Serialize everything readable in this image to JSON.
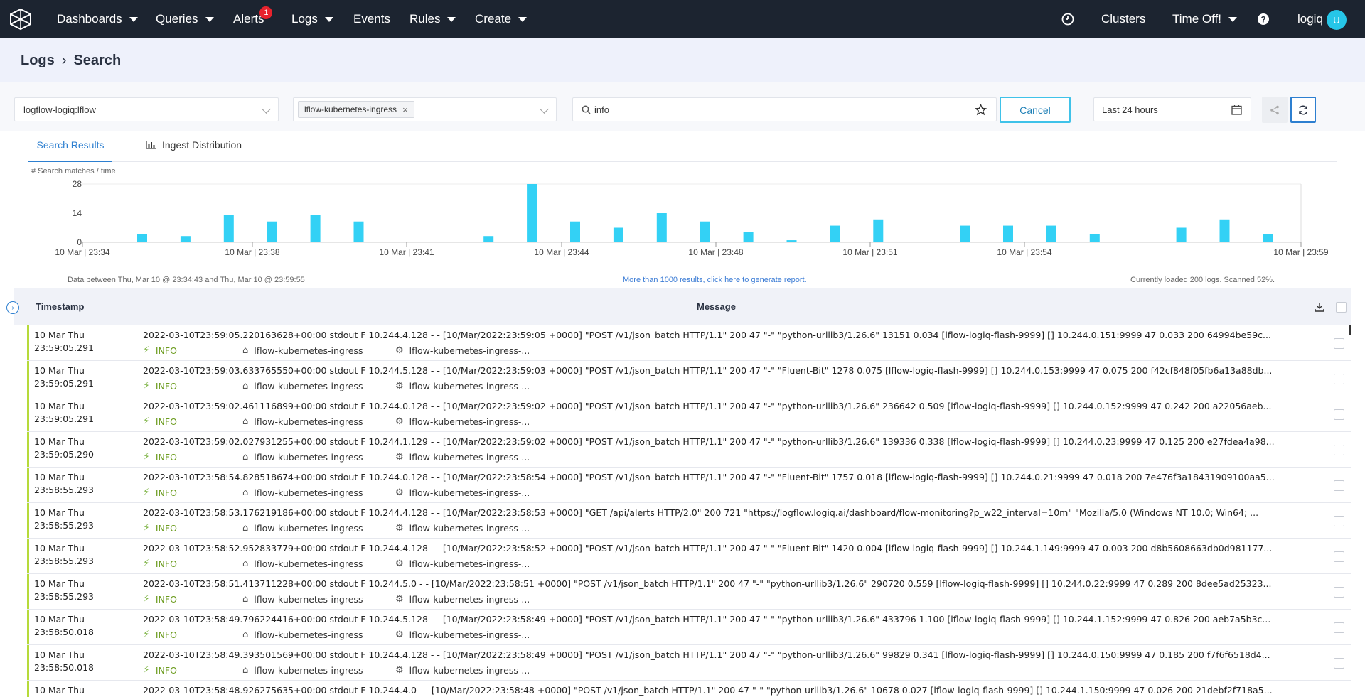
{
  "nav": {
    "items": [
      {
        "label": "Dashboards",
        "caret": true
      },
      {
        "label": "Queries",
        "caret": true
      },
      {
        "label": "Alerts",
        "caret": false,
        "badge": "1"
      },
      {
        "label": "Logs",
        "caret": true
      },
      {
        "label": "Events",
        "caret": false
      },
      {
        "label": "Rules",
        "caret": true
      },
      {
        "label": "Create",
        "caret": true
      }
    ],
    "right": {
      "clusters_label": "Clusters",
      "timeoff_label": "Time Off!",
      "user_label": "logiq",
      "avatar_initial": "U"
    }
  },
  "breadcrumb": {
    "parent": "Logs",
    "current": "Search"
  },
  "filters": {
    "source_value": "logflow-logiq:lflow",
    "app_tag": "lflow-kubernetes-ingress",
    "search_value": "info",
    "cancel_label": "Cancel",
    "time_range": "Last 24 hours"
  },
  "tabs": {
    "active": "Search Results",
    "second": "Ingest Distribution"
  },
  "chart_data": {
    "type": "bar",
    "ylabel": "# Search matches / time",
    "yticks": [
      0,
      14,
      28
    ],
    "ylim": [
      0,
      28
    ],
    "xtick_labels": [
      "10 Mar | 23:34",
      "10 Mar | 23:38",
      "10 Mar | 23:41",
      "10 Mar | 23:44",
      "10 Mar | 23:48",
      "10 Mar | 23:51",
      "10 Mar | 23:54",
      "10 Mar | 23:59"
    ],
    "bar_color": "#33d1f5",
    "values": [
      4,
      3,
      13,
      10,
      13,
      10,
      0,
      0,
      3,
      28,
      10,
      7,
      14,
      10,
      5,
      1,
      8,
      11,
      0,
      8,
      8,
      8,
      4,
      0,
      7,
      11,
      4
    ]
  },
  "summary": {
    "range_text": "Data between  Thu, Mar 10 @ 23:34:43  and Thu, Mar 10 @ 23:59:55",
    "link_text": "More than 1000 results, click here to generate report.",
    "loaded_text": "Currently loaded 200 logs.   Scanned 52%."
  },
  "table": {
    "col_timestamp": "Timestamp",
    "col_message": "Message",
    "rows": [
      {
        "date": "10 Mar Thu",
        "time": "23:59:05.291",
        "message": "2022-03-10T23:59:05.220163628+00:00 stdout F 10.244.4.128 - - [10/Mar/2022:23:59:05 +0000] \"POST /v1/json_batch HTTP/1.1\" 200 47 \"-\" \"python-urllib3/1.26.6\" 13151 0.034 [lflow-logiq-flash-9999] [] 10.244.0.151:9999 47 0.033 200 64994be59c...",
        "level": "INFO",
        "app": "lflow-kubernetes-ingress",
        "proc": "lflow-kubernetes-ingress-..."
      },
      {
        "date": "10 Mar Thu",
        "time": "23:59:05.291",
        "message": "2022-03-10T23:59:03.633765550+00:00 stdout F 10.244.5.128 - - [10/Mar/2022:23:59:03 +0000] \"POST /v1/json_batch HTTP/1.1\" 200 47 \"-\" \"Fluent-Bit\" 1278 0.075 [lflow-logiq-flash-9999] [] 10.244.0.153:9999 47 0.075 200 f42cf848f05fb6a13a88db...",
        "level": "INFO",
        "app": "lflow-kubernetes-ingress",
        "proc": "lflow-kubernetes-ingress-..."
      },
      {
        "date": "10 Mar Thu",
        "time": "23:59:05.291",
        "message": "2022-03-10T23:59:02.461116899+00:00 stdout F 10.244.0.128 - - [10/Mar/2022:23:59:02 +0000] \"POST /v1/json_batch HTTP/1.1\" 200 47 \"-\" \"python-urllib3/1.26.6\" 236642 0.509 [lflow-logiq-flash-9999] [] 10.244.0.152:9999 47 0.242 200 a22056aeb...",
        "level": "INFO",
        "app": "lflow-kubernetes-ingress",
        "proc": "lflow-kubernetes-ingress-..."
      },
      {
        "date": "10 Mar Thu",
        "time": "23:59:05.290",
        "message": "2022-03-10T23:59:02.027931255+00:00 stdout F 10.244.1.129 - - [10/Mar/2022:23:59:02 +0000] \"POST /v1/json_batch HTTP/1.1\" 200 47 \"-\" \"python-urllib3/1.26.6\" 139336 0.338 [lflow-logiq-flash-9999] [] 10.244.0.23:9999 47 0.125 200 e27fdea4a98...",
        "level": "INFO",
        "app": "lflow-kubernetes-ingress",
        "proc": "lflow-kubernetes-ingress-..."
      },
      {
        "date": "10 Mar Thu",
        "time": "23:58:55.293",
        "message": "2022-03-10T23:58:54.828518674+00:00 stdout F 10.244.0.128 - - [10/Mar/2022:23:58:54 +0000] \"POST /v1/json_batch HTTP/1.1\" 200 47 \"-\" \"Fluent-Bit\" 1757 0.018 [lflow-logiq-flash-9999] [] 10.244.0.21:9999 47 0.018 200 7e476f3a18431909100aa5...",
        "level": "INFO",
        "app": "lflow-kubernetes-ingress",
        "proc": "lflow-kubernetes-ingress-..."
      },
      {
        "date": "10 Mar Thu",
        "time": "23:58:55.293",
        "message": "2022-03-10T23:58:53.176219186+00:00 stdout F 10.244.4.128 - - [10/Mar/2022:23:58:53 +0000] \"GET /api/alerts HTTP/2.0\" 200 721 \"https://logflow.logiq.ai/dashboard/flow-monitoring?p_w22_interval=10m\" \"Mozilla/5.0 (Windows NT 10.0; Win64; ...",
        "level": "INFO",
        "app": "lflow-kubernetes-ingress",
        "proc": "lflow-kubernetes-ingress-..."
      },
      {
        "date": "10 Mar Thu",
        "time": "23:58:55.293",
        "message": "2022-03-10T23:58:52.952833779+00:00 stdout F 10.244.4.128 - - [10/Mar/2022:23:58:52 +0000] \"POST /v1/json_batch HTTP/1.1\" 200 47 \"-\" \"Fluent-Bit\" 1420 0.004 [lflow-logiq-flash-9999] [] 10.244.1.149:9999 47 0.003 200 d8b5608663db0d981177...",
        "level": "INFO",
        "app": "lflow-kubernetes-ingress",
        "proc": "lflow-kubernetes-ingress-..."
      },
      {
        "date": "10 Mar Thu",
        "time": "23:58:55.293",
        "message": "2022-03-10T23:58:51.413711228+00:00 stdout F 10.244.5.0 - - [10/Mar/2022:23:58:51 +0000] \"POST /v1/json_batch HTTP/1.1\" 200 47 \"-\" \"python-urllib3/1.26.6\" 290720 0.559 [lflow-logiq-flash-9999] [] 10.244.0.22:9999 47 0.289 200 8dee5ad25323...",
        "level": "INFO",
        "app": "lflow-kubernetes-ingress",
        "proc": "lflow-kubernetes-ingress-..."
      },
      {
        "date": "10 Mar Thu",
        "time": "23:58:50.018",
        "message": "2022-03-10T23:58:49.796224416+00:00 stdout F 10.244.5.128 - - [10/Mar/2022:23:58:49 +0000] \"POST /v1/json_batch HTTP/1.1\" 200 47 \"-\" \"python-urllib3/1.26.6\" 433796 1.100 [lflow-logiq-flash-9999] [] 10.244.1.152:9999 47 0.826 200 aeb7a5b3c...",
        "level": "INFO",
        "app": "lflow-kubernetes-ingress",
        "proc": "lflow-kubernetes-ingress-..."
      },
      {
        "date": "10 Mar Thu",
        "time": "23:58:50.018",
        "message": "2022-03-10T23:58:49.393501569+00:00 stdout F 10.244.4.128 - - [10/Mar/2022:23:58:49 +0000] \"POST /v1/json_batch HTTP/1.1\" 200 47 \"-\" \"python-urllib3/1.26.6\" 99829 0.341 [lflow-logiq-flash-9999] [] 10.244.0.150:9999 47 0.185 200 f7f6f6518d4...",
        "level": "INFO",
        "app": "lflow-kubernetes-ingress",
        "proc": "lflow-kubernetes-ingress-..."
      },
      {
        "date": "10 Mar Thu",
        "time": "",
        "message": "2022-03-10T23:58:48.926275635+00:00 stdout F 10.244.4.0 - - [10/Mar/2022:23:58:48 +0000] \"POST /v1/json_batch HTTP/1.1\" 200 47 \"-\" \"python-urllib3/1.26.6\" 10678 0.027 [lflow-logiq-flash-9999] [] 10.244.1.150:9999 47 0.026 200 21debf2f718a5...",
        "level": "",
        "app": "",
        "proc": ""
      }
    ]
  }
}
